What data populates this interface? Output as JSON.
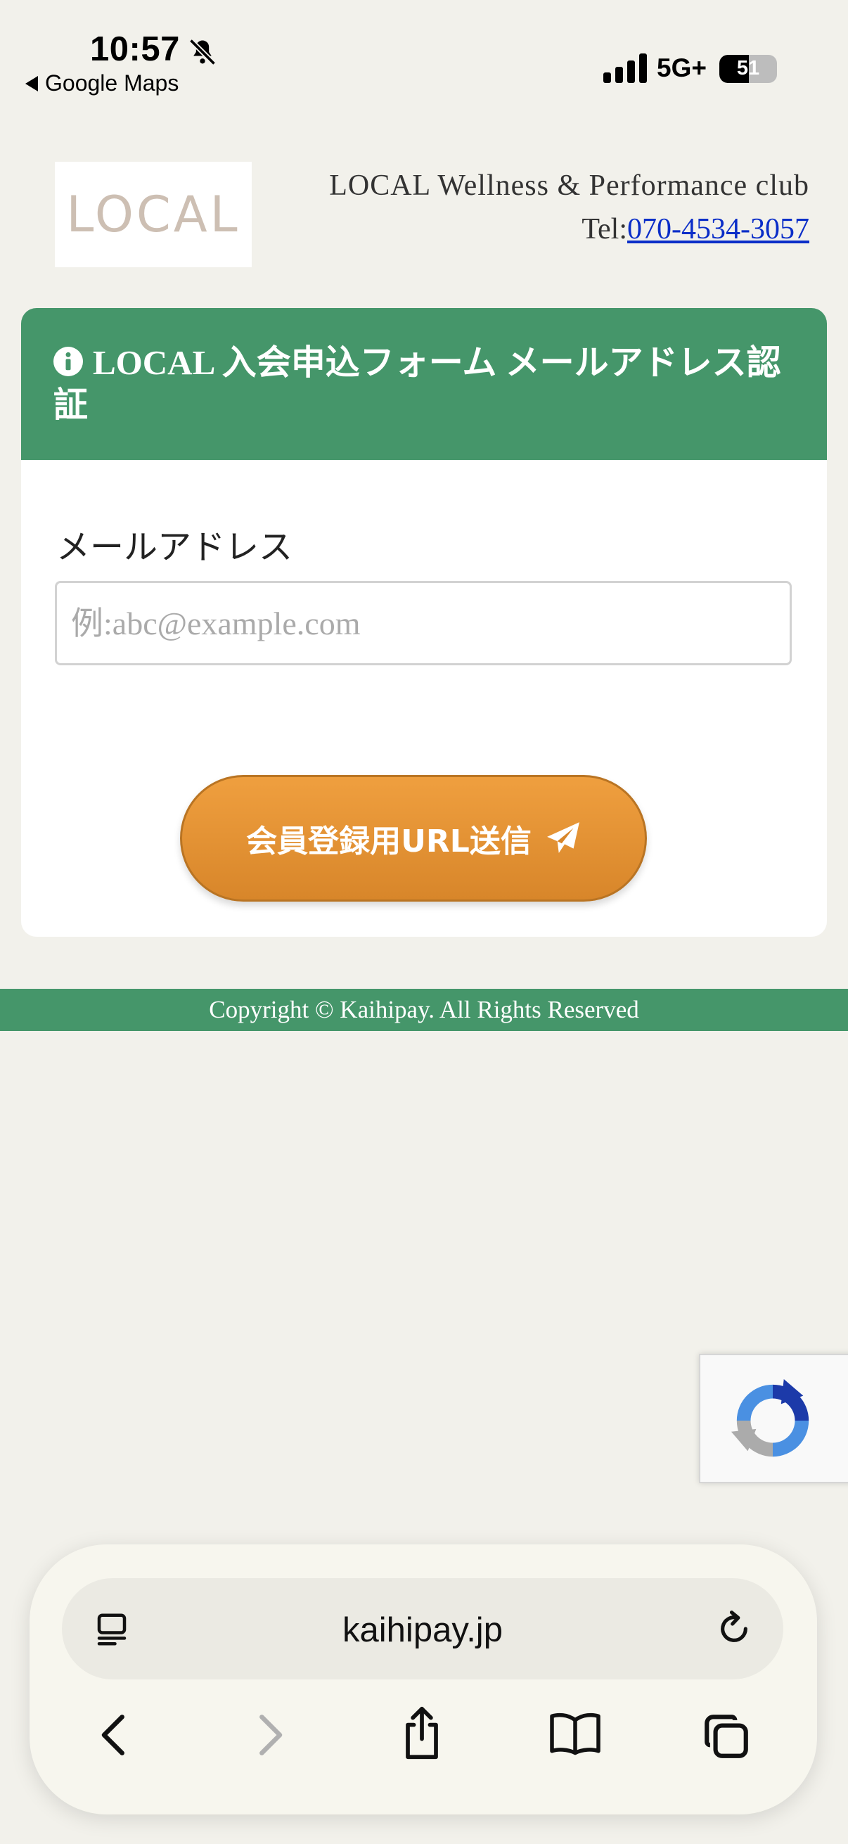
{
  "status_bar": {
    "time": "10:57",
    "back_app": "Google Maps",
    "network": "5G+",
    "battery": "51",
    "battery_level": 0.51
  },
  "header": {
    "logo_text": "LOCAL",
    "club_name": "LOCAL Wellness & Performance club",
    "tel_prefix": "Tel:",
    "tel_number": "070-4534-3057"
  },
  "form": {
    "title": "LOCAL 入会申込フォーム メールアドレス認証",
    "email_label": "メールアドレス",
    "email_placeholder": "例:abc@example.com",
    "email_value": "",
    "submit_label": "会員登録用URL送信"
  },
  "footer": {
    "copyright": "Copyright © Kaihipay. All Rights Reserved"
  },
  "browser": {
    "url": "kaihipay.jp",
    "toolbar_icons": [
      "reader-icon",
      "reload-icon",
      "back-icon",
      "forward-icon",
      "share-icon",
      "bookmarks-icon",
      "tabs-icon"
    ]
  },
  "colors": {
    "background": "#f2f1eb",
    "brand_green": "#45966a",
    "button_orange": "#e4912f",
    "link_blue": "#0b2ec8"
  }
}
